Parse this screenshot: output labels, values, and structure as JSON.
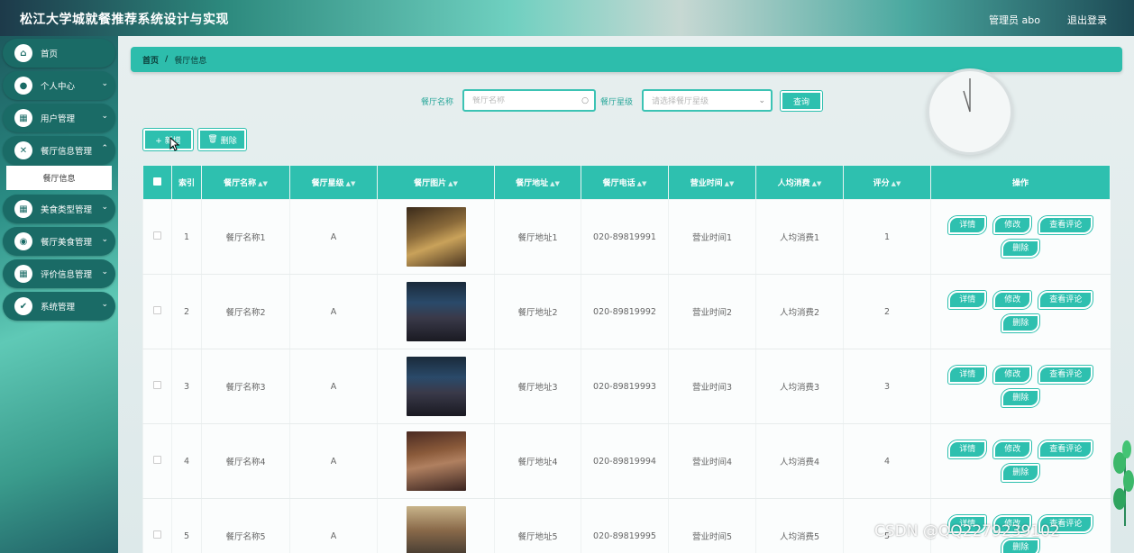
{
  "header": {
    "title": "松江大学城就餐推荐系统设计与实现",
    "user": "管理员 abo",
    "logout": "退出登录"
  },
  "sidebar": {
    "items": [
      {
        "label": "首页",
        "icon": "home-icon"
      },
      {
        "label": "个人中心",
        "icon": "user-icon"
      },
      {
        "label": "用户管理",
        "icon": "grid-icon"
      },
      {
        "label": "餐厅信息管理",
        "icon": "utensils-icon"
      },
      {
        "label": "美食类型管理",
        "icon": "grid-icon"
      },
      {
        "label": "餐厅美食管理",
        "icon": "location-icon"
      },
      {
        "label": "评价信息管理",
        "icon": "grid-icon"
      },
      {
        "label": "系统管理",
        "icon": "settings-icon"
      }
    ],
    "sub_item": "餐厅信息"
  },
  "breadcrumb": {
    "home": "首页",
    "separator": "/",
    "current": "餐厅信息"
  },
  "search": {
    "name_label": "餐厅名称",
    "name_placeholder": "餐厅名称",
    "rating_label": "餐厅星级",
    "rating_placeholder": "请选择餐厅星级",
    "query_button": "查询"
  },
  "actions": {
    "add": "+ 新增",
    "delete": "删除"
  },
  "table": {
    "columns": [
      "索引",
      "餐厅名称",
      "餐厅星级",
      "餐厅图片",
      "餐厅地址",
      "餐厅电话",
      "营业时间",
      "人均消费",
      "评分",
      "操作"
    ],
    "rows": [
      {
        "index": "1",
        "name": "餐厅名称1",
        "rating": "A",
        "address": "餐厅地址1",
        "phone": "020-89819991",
        "hours": "营业时间1",
        "avg": "人均消费1",
        "score": "1"
      },
      {
        "index": "2",
        "name": "餐厅名称2",
        "rating": "A",
        "address": "餐厅地址2",
        "phone": "020-89819992",
        "hours": "营业时间2",
        "avg": "人均消费2",
        "score": "2"
      },
      {
        "index": "3",
        "name": "餐厅名称3",
        "rating": "A",
        "address": "餐厅地址3",
        "phone": "020-89819993",
        "hours": "营业时间3",
        "avg": "人均消费3",
        "score": "3"
      },
      {
        "index": "4",
        "name": "餐厅名称4",
        "rating": "A",
        "address": "餐厅地址4",
        "phone": "020-89819994",
        "hours": "营业时间4",
        "avg": "人均消费4",
        "score": "4"
      },
      {
        "index": "5",
        "name": "餐厅名称5",
        "rating": "A",
        "address": "餐厅地址5",
        "phone": "020-89819995",
        "hours": "营业时间5",
        "avg": "人均消费5",
        "score": "5"
      }
    ],
    "row_actions": [
      "详情",
      "修改",
      "查看评论",
      "删除"
    ]
  },
  "watermark": "CSDN @QQ2279239102",
  "colors": {
    "accent": "#2ec0af",
    "sidebar_item": "#1a6b66"
  }
}
